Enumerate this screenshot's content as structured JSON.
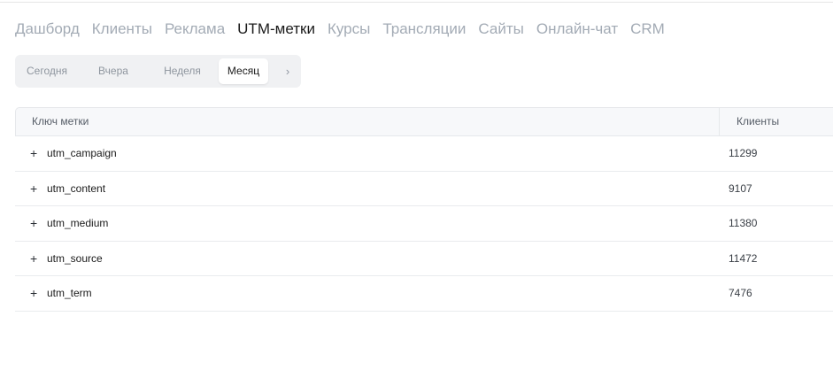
{
  "nav": {
    "items": [
      "Дашборд",
      "Клиенты",
      "Реклама",
      "UTM-метки",
      "Курсы",
      "Трансляции",
      "Сайты",
      "Онлайн-чат",
      "CRM"
    ],
    "active": "UTM-метки"
  },
  "period": {
    "tabs": [
      "Сегодня",
      "Вчера",
      "Неделя",
      "Месяц"
    ],
    "active": "Месяц",
    "next_arrow": "›"
  },
  "table": {
    "headers": {
      "key": "Ключ метки",
      "clients": "Клиенты"
    },
    "expand_symbol": "+",
    "rows": [
      {
        "key": "utm_campaign",
        "clients": "11299"
      },
      {
        "key": "utm_content",
        "clients": "9107"
      },
      {
        "key": "utm_medium",
        "clients": "11380"
      },
      {
        "key": "utm_source",
        "clients": "11472"
      },
      {
        "key": "utm_term",
        "clients": "7476"
      }
    ]
  }
}
